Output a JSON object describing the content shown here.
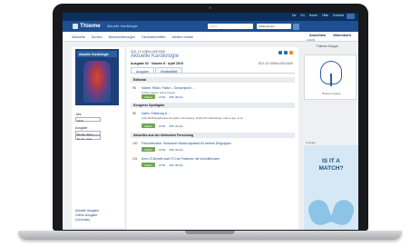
{
  "topbar": {
    "links": [
      "De",
      "En",
      "Home",
      "Hilfe",
      "Kontakt"
    ]
  },
  "header": {
    "logo": "Thieme",
    "section": "Aktuelle Kardiologie",
    "search_placeholder": "Suche",
    "select_value": "Volltextsuche"
  },
  "nav": {
    "items": [
      "Startseite",
      "Suchen",
      "Neuerscheinungen",
      "Fachzeitschriften",
      "Weitere Inhalte"
    ],
    "right": [
      "Anmelden",
      "Warenkorb"
    ],
    "sub": "LOGIN"
  },
  "institution": "Thieme Gruppe",
  "sidebar": {
    "cover_title": "Aktuelle Kardiologie",
    "jahr_label": "Jahr",
    "jahr_value": "2019",
    "ausgabe_label": "Ausgabe",
    "ausgabe_items": [
      "Nr. 02 · April",
      "Nr. 01 · Feb"
    ],
    "links": [
      "Aktuelle Ausgabe",
      "Online-Ausgabe",
      "(Vorschau)"
    ]
  },
  "main": {
    "doi": "DOI: 10.1055/s-005-0000",
    "journal": "Aktuelle Kardiologie",
    "issue": "Ausgabe 02 · Volume 8 · April 2019",
    "issue_doi": "DOI: 10.1055/s-005-0000",
    "tabs": [
      "Ausgabe",
      "Vorabartikel"
    ],
    "sections": [
      {
        "heading": "Editorial",
        "articles": [
          {
            "page": "95",
            "title": "Marker, Risiko, Faktor – Schwerpunkt …",
            "authors": "Lothar Lippert, Hans Lippert",
            "actions": [
              "Volltext",
              "HTML",
              "PDF (80 kb)"
            ]
          }
        ]
      },
      {
        "heading": "Kongress Spotlights",
        "articles": [
          {
            "page": "98",
            "title": "Daten, Erfahrung & …",
            "authors": "AHA 2018 Ergebnisse kompakt, Henneberg, Institut für Kardiologie, Hans Lipp, et al.",
            "actions": [
              "Volltext",
              "HTML",
              "PDF (81 kb)"
            ]
          }
        ]
      },
      {
        "heading": "Aktuelles aus der klinischen Forschung",
        "articles": [
          {
            "page": "100",
            "title": "Fixkombination: Wirksamer Blutdruckpatient für weitere Zielgruppen",
            "authors": "",
            "actions": [
              "Volltext",
              "HTML",
              "PDF (92 kb)"
            ]
          },
          {
            "page": "101",
            "title": "Kein CV-Benefit nach PCI bei Patienten mit Vorhofflimmern",
            "authors": "",
            "actions": [
              "Volltext",
              "HTML",
              "PDF (80 kb)"
            ]
          }
        ]
      }
    ]
  },
  "right": {
    "logo_caption": "Thieme Gruppe",
    "ad_label": "Anzeige",
    "ad_text": "IS IT A MATCH?"
  },
  "colors": {
    "dark_blue": "#0c2f5e",
    "brand_blue": "#1d4f92",
    "green": "#6aa84f"
  }
}
